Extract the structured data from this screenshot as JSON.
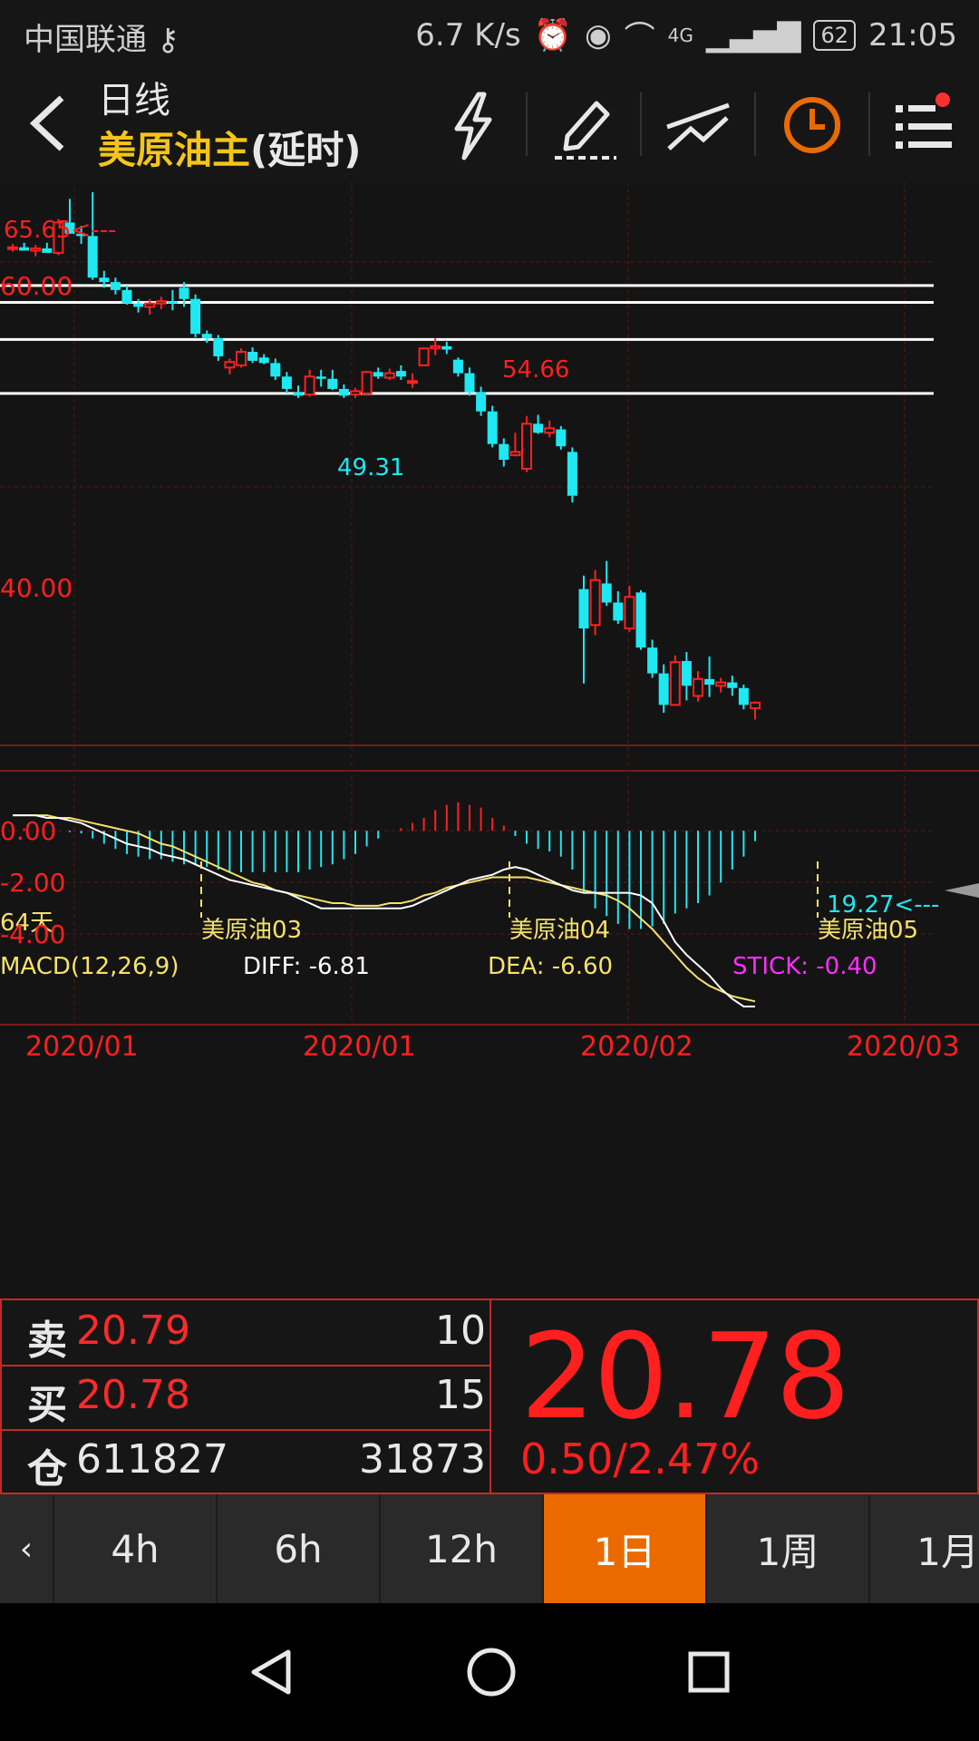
{
  "status": {
    "carrier": "中国联通",
    "speed": "6.7 K/s",
    "network": "4G",
    "battery": "62",
    "time": "21:05"
  },
  "header": {
    "timeframe": "日线",
    "title": "美原油主",
    "title_suffix": "(延时)"
  },
  "chart_labels": {
    "price_high": "65.65<---",
    "price_60": "60.00",
    "price_40": "40.00",
    "high_mid": "54.66",
    "low_mid": "49.31",
    "last_low": "19.27<---",
    "days": "64天",
    "contract_03": "美原油03",
    "contract_04": "美原油04",
    "contract_05": "美原油05",
    "macd": "MACD(12,26,9)",
    "diff": "DIFF: -6.81",
    "dea": "DEA: -6.60",
    "stick": "STICK: -0.40",
    "macd_0": "0.00",
    "macd_m2": "-2.00",
    "macd_m4": "-4.00",
    "dates": [
      "2020/01",
      "2020/01",
      "2020/02",
      "2020/03"
    ]
  },
  "chart_data": {
    "type": "candlestick",
    "ylim": [
      17,
      67
    ],
    "candles": [
      [
        61.2,
        61.6,
        60.9,
        61.3
      ],
      [
        61.3,
        61.7,
        61.0,
        61.0
      ],
      [
        61.0,
        61.5,
        60.5,
        61.2
      ],
      [
        61.2,
        61.7,
        60.9,
        60.8
      ],
      [
        60.8,
        63.8,
        60.6,
        63.5
      ],
      [
        63.5,
        65.6,
        62.8,
        62.5
      ],
      [
        62.5,
        63.2,
        61.6,
        62.3
      ],
      [
        62.3,
        66.2,
        58.4,
        58.6
      ],
      [
        58.6,
        59.2,
        57.7,
        58.2
      ],
      [
        58.2,
        58.6,
        57.1,
        57.5
      ],
      [
        57.5,
        57.9,
        56.2,
        56.3
      ],
      [
        56.3,
        56.7,
        55.5,
        56.0
      ],
      [
        56.0,
        56.7,
        55.3,
        56.3
      ],
      [
        56.3,
        56.9,
        55.8,
        56.5
      ],
      [
        56.5,
        57.5,
        55.7,
        56.3
      ],
      [
        57.7,
        58.2,
        56.0,
        56.7
      ],
      [
        56.7,
        57.1,
        53.3,
        53.6
      ],
      [
        53.6,
        53.9,
        52.8,
        53.2
      ],
      [
        53.2,
        53.5,
        51.2,
        51.6
      ],
      [
        50.6,
        51.4,
        50.0,
        51.1
      ],
      [
        50.8,
        52.3,
        50.6,
        52.0
      ],
      [
        52.0,
        52.4,
        51.0,
        51.2
      ],
      [
        51.5,
        51.8,
        50.9,
        51.0
      ],
      [
        51.0,
        51.4,
        49.5,
        49.8
      ],
      [
        49.8,
        50.2,
        48.3,
        48.7
      ],
      [
        48.4,
        49.0,
        47.9,
        48.1
      ],
      [
        48.2,
        50.4,
        48.0,
        49.8
      ],
      [
        49.8,
        50.4,
        48.9,
        49.6
      ],
      [
        49.6,
        50.4,
        48.6,
        48.7
      ],
      [
        48.7,
        49.1,
        47.9,
        48.1
      ],
      [
        48.2,
        48.8,
        47.9,
        48.5
      ],
      [
        48.3,
        50.3,
        48.1,
        50.2
      ],
      [
        50.2,
        50.6,
        49.6,
        49.8
      ],
      [
        49.7,
        50.5,
        49.5,
        50.1
      ],
      [
        50.3,
        50.8,
        49.5,
        49.8
      ],
      [
        49.3,
        50.1,
        48.8,
        49.4
      ],
      [
        50.8,
        52.4,
        50.8,
        52.3
      ],
      [
        52.3,
        53.2,
        51.7,
        52.5
      ],
      [
        52.5,
        52.9,
        51.8,
        52.2
      ],
      [
        51.3,
        51.5,
        49.8,
        50.1
      ],
      [
        50.1,
        50.6,
        48.1,
        48.4
      ],
      [
        48.4,
        48.9,
        46.3,
        46.7
      ],
      [
        46.7,
        47.2,
        43.5,
        43.8
      ],
      [
        43.8,
        44.3,
        41.8,
        42.4
      ],
      [
        42.8,
        44.8,
        42.7,
        43.1
      ],
      [
        41.6,
        46.3,
        41.3,
        45.6
      ],
      [
        45.6,
        46.4,
        44.7,
        44.8
      ],
      [
        44.8,
        45.9,
        44.4,
        45.2
      ],
      [
        45.1,
        45.4,
        43.3,
        43.6
      ],
      [
        43.1,
        43.5,
        38.6,
        39.2
      ],
      [
        30.9,
        32.1,
        22.5,
        27.4
      ],
      [
        27.7,
        32.6,
        26.8,
        31.7
      ],
      [
        31.4,
        33.4,
        29.4,
        29.7
      ],
      [
        29.7,
        30.7,
        27.8,
        28.1
      ],
      [
        27.4,
        31.2,
        27.1,
        30.2
      ],
      [
        30.6,
        30.8,
        25.5,
        25.7
      ],
      [
        25.7,
        26.4,
        23.0,
        23.4
      ],
      [
        23.4,
        24.2,
        19.9,
        20.6
      ],
      [
        20.6,
        25.0,
        20.5,
        24.4
      ],
      [
        24.5,
        25.3,
        21.0,
        22.3
      ],
      [
        21.4,
        23.6,
        20.9,
        22.9
      ],
      [
        22.9,
        24.9,
        21.3,
        22.4
      ],
      [
        22.3,
        23.0,
        21.7,
        22.6
      ],
      [
        22.6,
        23.2,
        21.4,
        22.1
      ],
      [
        22.1,
        22.4,
        20.2,
        20.6
      ],
      [
        20.3,
        20.9,
        19.3,
        20.8
      ]
    ],
    "hlines": [
      57.9,
      56.4,
      53.1,
      48.3
    ],
    "macd": {
      "ylim": [
        -7.5,
        1.2
      ],
      "stick": [
        0.0,
        0.1,
        0.0,
        0.0,
        0.0,
        -0.05,
        -0.1,
        -0.3,
        -0.5,
        -0.7,
        -0.9,
        -1.0,
        -1.1,
        -1.1,
        -1.2,
        -1.3,
        -1.3,
        -1.4,
        -1.5,
        -1.6,
        -1.6,
        -1.6,
        -1.6,
        -1.6,
        -1.6,
        -1.6,
        -1.5,
        -1.4,
        -1.3,
        -1.1,
        -0.9,
        -0.6,
        -0.3,
        0.0,
        0.1,
        0.3,
        0.5,
        0.8,
        1.0,
        1.1,
        1.0,
        0.9,
        0.5,
        0.2,
        -0.2,
        -0.5,
        -0.7,
        -0.8,
        -1.0,
        -1.5,
        -2.4,
        -3.0,
        -3.3,
        -3.6,
        -3.8,
        -3.8,
        -3.7,
        -3.6,
        -3.2,
        -3.0,
        -2.8,
        -2.5,
        -2.0,
        -1.5,
        -1.0,
        -0.4
      ],
      "diff": [
        0.6,
        0.6,
        0.6,
        0.5,
        0.5,
        0.4,
        0.3,
        0.1,
        -0.1,
        -0.3,
        -0.5,
        -0.6,
        -0.7,
        -0.9,
        -1.0,
        -1.1,
        -1.3,
        -1.5,
        -1.7,
        -1.9,
        -2.0,
        -2.1,
        -2.2,
        -2.3,
        -2.4,
        -2.6,
        -2.8,
        -3.0,
        -3.0,
        -3.0,
        -3.0,
        -3.0,
        -3.0,
        -3.0,
        -3.0,
        -2.9,
        -2.7,
        -2.5,
        -2.3,
        -2.1,
        -1.9,
        -1.8,
        -1.7,
        -1.5,
        -1.4,
        -1.5,
        -1.7,
        -1.9,
        -2.1,
        -2.3,
        -2.4,
        -2.4,
        -2.4,
        -2.4,
        -2.4,
        -2.5,
        -2.8,
        -3.5,
        -4.3,
        -4.8,
        -5.2,
        -5.6,
        -6.1,
        -6.5,
        -6.8,
        -6.8
      ],
      "dea": [
        0.6,
        0.6,
        0.6,
        0.6,
        0.5,
        0.5,
        0.4,
        0.3,
        0.2,
        0.1,
        0.0,
        -0.1,
        -0.3,
        -0.5,
        -0.6,
        -0.8,
        -1.0,
        -1.2,
        -1.4,
        -1.6,
        -1.8,
        -2.0,
        -2.1,
        -2.3,
        -2.4,
        -2.5,
        -2.6,
        -2.7,
        -2.8,
        -2.8,
        -2.9,
        -2.9,
        -2.9,
        -2.8,
        -2.8,
        -2.7,
        -2.5,
        -2.4,
        -2.2,
        -2.1,
        -2.0,
        -1.9,
        -1.8,
        -1.8,
        -1.8,
        -1.8,
        -1.9,
        -2.0,
        -2.1,
        -2.2,
        -2.3,
        -2.4,
        -2.5,
        -2.7,
        -3.0,
        -3.4,
        -3.8,
        -4.3,
        -4.8,
        -5.3,
        -5.7,
        -6.0,
        -6.2,
        -6.4,
        -6.5,
        -6.6
      ]
    }
  },
  "quote": {
    "sell_label": "卖",
    "sell_price": "20.79",
    "sell_vol": "10",
    "buy_label": "买",
    "buy_price": "20.78",
    "buy_vol": "15",
    "oi_label": "仓",
    "oi_value": "611827",
    "oi_change": "31873",
    "last_price": "20.78",
    "change": "0.50/2.47%"
  },
  "tabs": [
    "4h",
    "6h",
    "12h",
    "1日",
    "1周",
    "1月"
  ],
  "colors": {
    "up": "#ff2020",
    "down": "#1ee8f2",
    "accent": "#ea6a00",
    "title": "#f5c518"
  }
}
